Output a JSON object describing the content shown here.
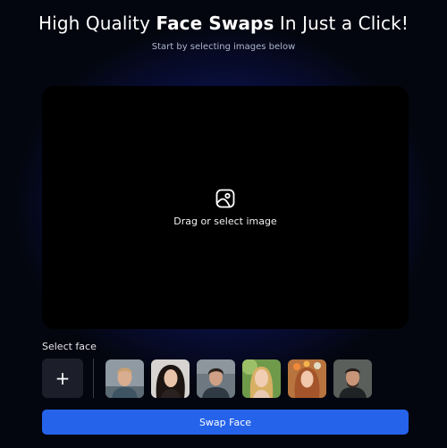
{
  "header": {
    "title_pre": "High Quality ",
    "title_bold": "Face Swaps",
    "title_post": " In Just a Click!",
    "subtitle": "Start by selecting images below"
  },
  "dropzone": {
    "icon": "image-icon",
    "label": "Drag or select image"
  },
  "face_picker": {
    "label": "Select face",
    "add_label": "+",
    "faces": [
      {
        "name": "face-1"
      },
      {
        "name": "face-2"
      },
      {
        "name": "face-3"
      },
      {
        "name": "face-4"
      },
      {
        "name": "face-5"
      },
      {
        "name": "face-6"
      }
    ]
  },
  "actions": {
    "swap_label": "Swap Face"
  },
  "colors": {
    "accent": "#2563eb",
    "background": "#04060f",
    "glow": "#2846ff",
    "dropzone": "#000000"
  }
}
